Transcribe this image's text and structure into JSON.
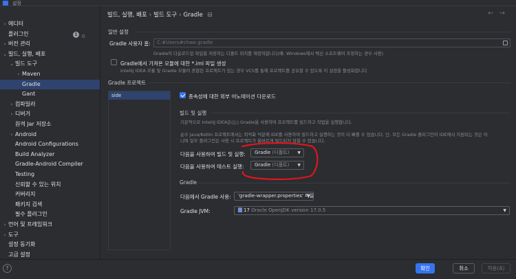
{
  "window": {
    "title": "설정"
  },
  "sidebar": {
    "items": [
      {
        "label": "에디터",
        "arrow": "›",
        "indent": 0,
        "selected": false
      },
      {
        "label": "플러그인",
        "arrow": "",
        "indent": 0,
        "selected": false,
        "badge": "1"
      },
      {
        "label": "버전 관리",
        "arrow": "›",
        "indent": 0,
        "selected": false
      },
      {
        "label": "빌드, 실행, 배포",
        "arrow": "⌄",
        "indent": 0,
        "selected": false
      },
      {
        "label": "빌드 도구",
        "arrow": "⌄",
        "indent": 1,
        "selected": false
      },
      {
        "label": "Maven",
        "arrow": "›",
        "indent": 2,
        "selected": false
      },
      {
        "label": "Gradle",
        "arrow": "",
        "indent": 2,
        "selected": true
      },
      {
        "label": "Gant",
        "arrow": "",
        "indent": 2,
        "selected": false
      },
      {
        "label": "컴파일러",
        "arrow": "›",
        "indent": 1,
        "selected": false
      },
      {
        "label": "디버거",
        "arrow": "›",
        "indent": 1,
        "selected": false
      },
      {
        "label": "원격 Jar 저장소",
        "arrow": "",
        "indent": 1,
        "selected": false
      },
      {
        "label": "Android",
        "arrow": "›",
        "indent": 1,
        "selected": false
      },
      {
        "label": "Android Configurations",
        "arrow": "",
        "indent": 1,
        "selected": false
      },
      {
        "label": "Build Analyzer",
        "arrow": "",
        "indent": 1,
        "selected": false
      },
      {
        "label": "Gradle-Android Compiler",
        "arrow": "",
        "indent": 1,
        "selected": false
      },
      {
        "label": "Testing",
        "arrow": "",
        "indent": 1,
        "selected": false
      },
      {
        "label": "신뢰할 수 있는 위치",
        "arrow": "",
        "indent": 1,
        "selected": false
      },
      {
        "label": "커버리지",
        "arrow": "",
        "indent": 1,
        "selected": false
      },
      {
        "label": "패키지 검색",
        "arrow": "",
        "indent": 1,
        "selected": false
      },
      {
        "label": "필수 플러그인",
        "arrow": "",
        "indent": 1,
        "selected": false
      },
      {
        "label": "언어 및 프레임워크",
        "arrow": "›",
        "indent": 0,
        "selected": false
      },
      {
        "label": "도구",
        "arrow": "›",
        "indent": 0,
        "selected": false
      },
      {
        "label": "설정 동기화",
        "arrow": "",
        "indent": 0,
        "selected": false
      },
      {
        "label": "고급 설정",
        "arrow": "",
        "indent": 0,
        "selected": false
      }
    ]
  },
  "breadcrumb": {
    "part1": "빌드, 실행, 배포",
    "part2": "빌드 도구",
    "part3": "Gradle"
  },
  "general": {
    "header": "일반 설정",
    "user_home_label": "Gradle 사용자 홈:",
    "user_home_value": "C:#Users#chwe.gradle",
    "user_home_hint": "Gradle이 다운로드된 파일을 저장하는 디폴트 위치를 재정의합니다(예: Windows에서 백신 소프트웨어 조정하는 경우 사용)",
    "iml_label": "Gradle에서 가져온 모듈에 대한 *.iml 파일 생성",
    "iml_hint": "IntelliJ IDEA 모듈 및 Gradle 모듈이 혼합된 프로젝트가 있는 경우 VCS를 통해 프로젝트를 공유할 수 있도록 이 설정을 활성화합니다"
  },
  "projects": {
    "header": "Gradle 프로젝트",
    "selected_project": "side",
    "download_label": "종속성에 대한 외부 어노테이션 다운로드"
  },
  "build_run": {
    "header": "빌드 및 실행",
    "hint1": "기본적으로 IntelliJ IDEA은(는) Gradle을 사용하여 프로젝트를 빌드하고 작업을 실행합니다.",
    "hint2a": "순수 Java/Kotlin 프로젝트에서는 최적화 덕분에 IDE를 사용하여 빌드하고 실행하는 것이 더 빠를 수 있습니다. 단, 모든 Gradle 플러그인이 IDE에서 지원되는 것은 아",
    "hint2b": "니며 일부 플러그인은 사용 시 프로젝트가 올바르게 빌드되지 않을 수 있습니다.",
    "build_label": "다음을 사용하여 빌드 및 실행:",
    "build_value": "Gradle",
    "build_suffix": "(디폴트)",
    "test_label": "다음을 사용하여 테스트 실행:",
    "test_value": "Gradle",
    "test_suffix": "(디폴트)"
  },
  "gradle": {
    "header": "Gradle",
    "use_label": "다음에서 Gradle 사용:",
    "use_value": "'gradle-wrapper.properties' 파일",
    "jvm_label": "Gradle JVM:",
    "jvm_value": "17",
    "jvm_suffix": "Oracle OpenJDK version 17.0.5"
  },
  "footer": {
    "help": "?",
    "ok": "확인",
    "cancel": "취소",
    "apply": "적용(A)"
  },
  "colors": {
    "accent": "#3574f0",
    "selection": "#2e436e",
    "annotation": "#e0151e"
  }
}
